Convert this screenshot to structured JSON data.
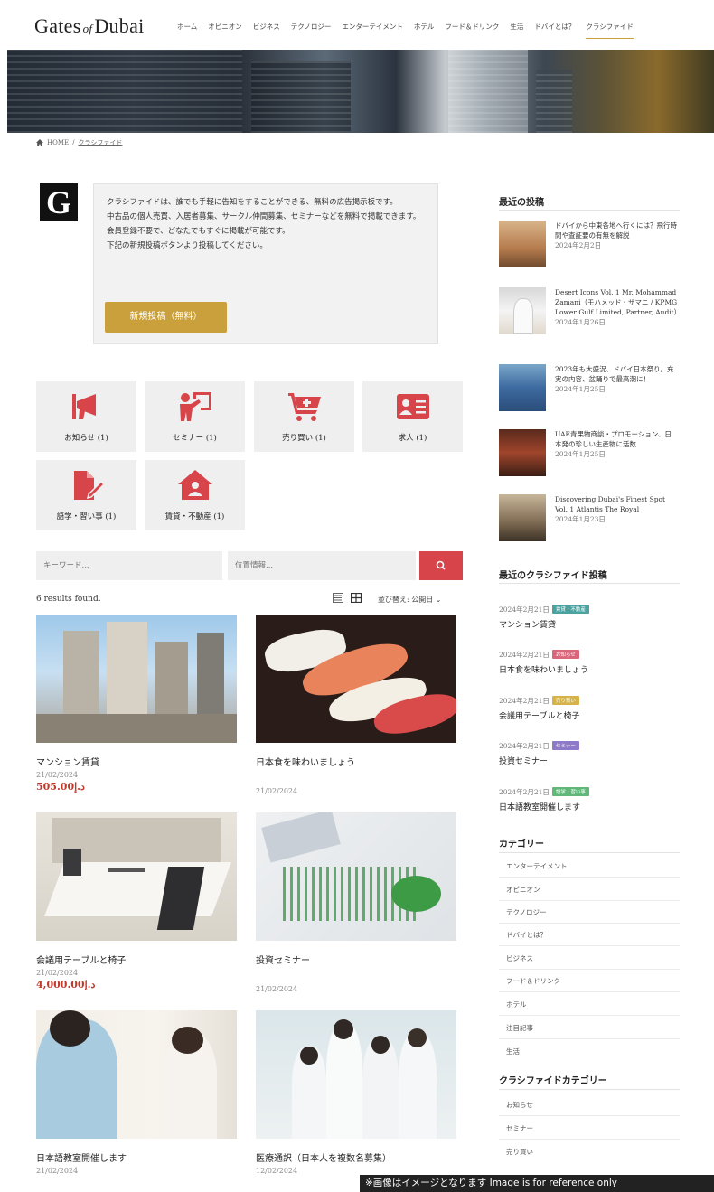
{
  "header": {
    "logo": {
      "left": "Gates",
      "of": "of",
      "right": "Dubai"
    },
    "nav": [
      "ホーム",
      "オピニオン",
      "ビジネス",
      "テクノロジー",
      "エンターテイメント",
      "ホテル",
      "フード＆ドリンク",
      "生活",
      "ドバイとは？",
      "クラシファイド"
    ],
    "active_nav": "クラシファイド"
  },
  "breadcrumb": {
    "home": "HOME",
    "separator": "/",
    "current": "クラシファイド"
  },
  "intro": {
    "logo_letter": "G",
    "lines": [
      "クラシファイドは、誰でも手軽に告知をすることができる、無料の広告掲示板です。",
      "中古品の個人売買、入居者募集、サークル仲間募集、セミナーなどを無料で掲載できます。",
      "会員登録不要で、どなたでもすぐに掲載が可能です。",
      "下記の新規投稿ボタンより投稿してください。"
    ],
    "button": "新規投稿（無料）"
  },
  "categories": [
    {
      "label": "お知らせ (1)",
      "icon": "megaphone-icon"
    },
    {
      "label": "セミナー (1)",
      "icon": "presenter-icon"
    },
    {
      "label": "売り買い (1)",
      "icon": "cart-icon"
    },
    {
      "label": "求人 (1)",
      "icon": "id-card-icon"
    },
    {
      "label": "語学・習い事 (1)",
      "icon": "document-edit-icon"
    },
    {
      "label": "賃貸・不動産 (1)",
      "icon": "house-user-icon"
    }
  ],
  "search": {
    "keyword_placeholder": "キーワード...",
    "location_placeholder": "位置情報...",
    "button_icon": "search-icon"
  },
  "results": {
    "count": "6 results found.",
    "sort_label": "並び替え: 公開日"
  },
  "listings": [
    {
      "title": "マンション賃貸",
      "date": "21/02/2024",
      "price": "505.00د.إ",
      "photo": "towers"
    },
    {
      "title": "日本食を味わいましょう",
      "date": "21/02/2024",
      "price": "",
      "photo": "sushi"
    },
    {
      "title": "会議用テーブルと椅子",
      "date": "21/02/2024",
      "price": "4,000.00د.إ",
      "photo": "meeting"
    },
    {
      "title": "投資セミナー",
      "date": "21/02/2024",
      "price": "",
      "photo": "charts"
    },
    {
      "title": "日本語教室開催します",
      "date": "21/02/2024",
      "price": "",
      "photo": "lesson"
    },
    {
      "title": "医療通訳（日本人を複数名募集）",
      "date": "12/02/2024",
      "price": "",
      "photo": "medical"
    }
  ],
  "sidebar": {
    "recent_posts_title": "最近の投稿",
    "recent_posts": [
      {
        "title": "ドバイから中東各地へ行くには？飛行時間や査証要の有無を解説",
        "date": "2024年2月2日"
      },
      {
        "title": "Desert Icons Vol. 1 Mr. Mohammad Zamani（モハメッド・ザマニ / KPMG Lower Gulf Limited, Partner, Audit）",
        "date": "2024年1月26日"
      },
      {
        "title": "2023年も大盛況、ドバイ日本祭り。充実の内容、盆踊りで最高潮に！",
        "date": "2024年1月25日"
      },
      {
        "title": "UAE青果物商談・プロモーション、日本発の珍しい生産物に活数",
        "date": "2024年1月25日"
      },
      {
        "title": "Discovering Dubai's Finest Spot Vol. 1 Atlantis The Royal",
        "date": "2024年1月23日"
      }
    ],
    "recent_classified_title": "最近のクラシファイド投稿",
    "recent_classified": [
      {
        "date": "2024年2月21日",
        "badge": "賃貸・不動産",
        "badge_color": "#4aa3a0",
        "title": "マンション賃貸"
      },
      {
        "date": "2024年2月21日",
        "badge": "お知らせ",
        "badge_color": "#d9667a",
        "title": "日本食を味わいましょう"
      },
      {
        "date": "2024年2月21日",
        "badge": "売り買い",
        "badge_color": "#d6b34a",
        "title": "会議用テーブルと椅子"
      },
      {
        "date": "2024年2月21日",
        "badge": "セミナー",
        "badge_color": "#8f7ac9",
        "title": "投資セミナー"
      },
      {
        "date": "2024年2月21日",
        "badge": "語学・習い事",
        "badge_color": "#5fb878",
        "title": "日本語教室開催します"
      }
    ],
    "categories_title": "カテゴリー",
    "categories": [
      "エンターテイメント",
      "オピニオン",
      "テクノロジー",
      "ドバイとは？",
      "ビジネス",
      "フード＆ドリンク",
      "ホテル",
      "注目記事",
      "生活"
    ],
    "classified_categories_title": "クラシファイドカテゴリー",
    "classified_categories": [
      "お知らせ",
      "セミナー",
      "売り買い"
    ]
  },
  "notice": "※画像はイメージとなります Image is for reference only",
  "colors": {
    "accent_gold": "#c9a03b",
    "accent_red": "#d7444a",
    "price_red": "#c0392b"
  }
}
